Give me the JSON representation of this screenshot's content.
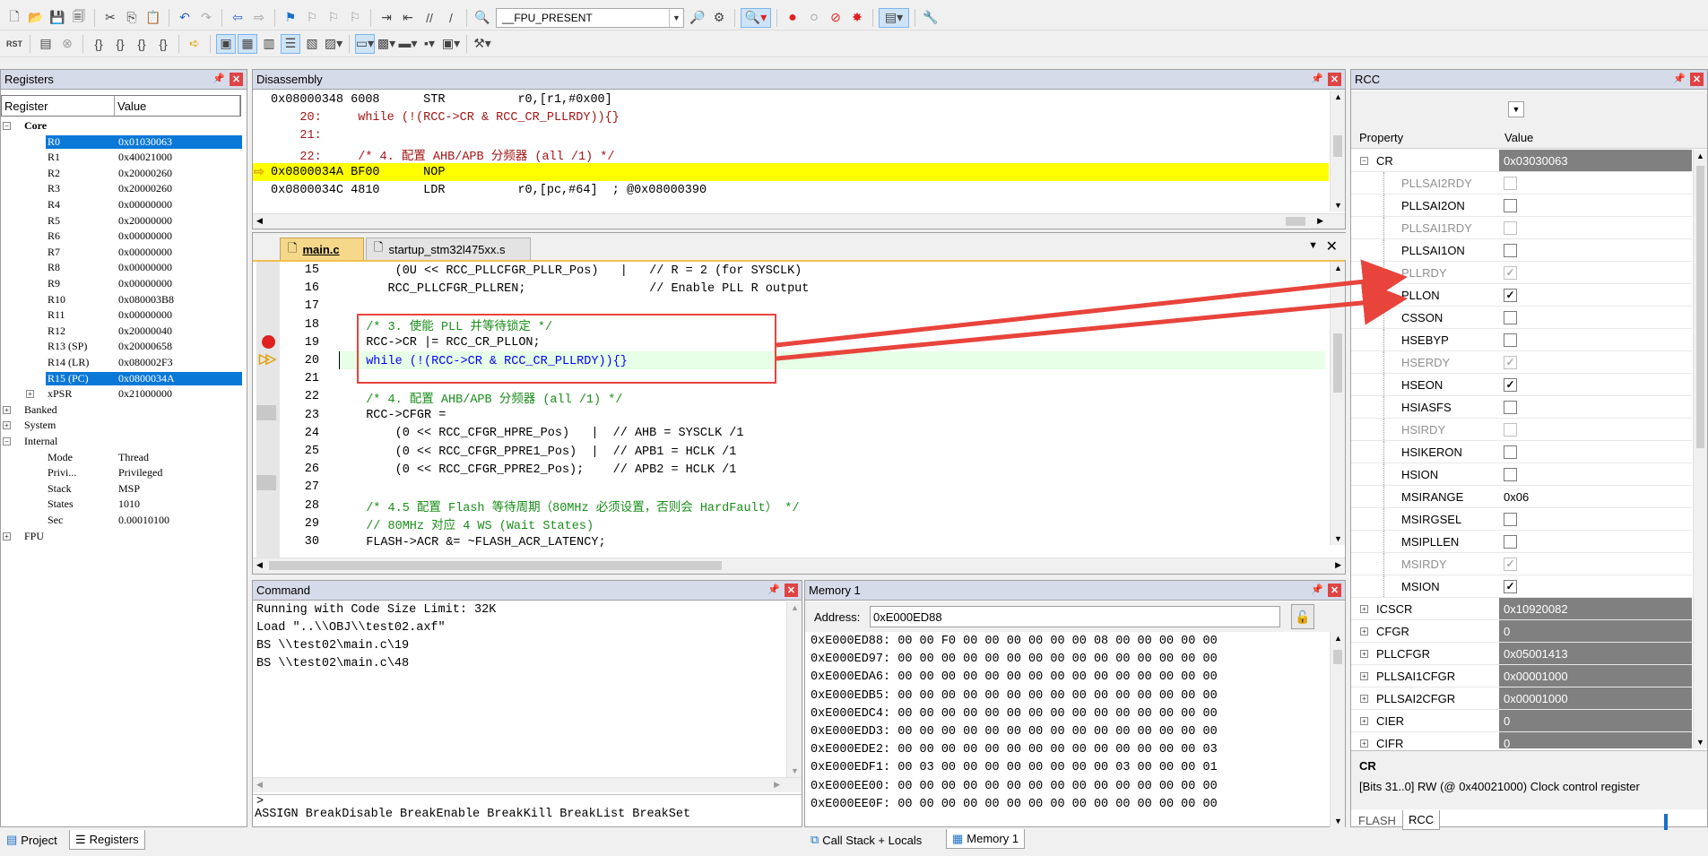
{
  "toolbar1": {
    "target_combo": "__FPU_PRESENT"
  },
  "registers": {
    "title": "Registers",
    "col_register": "Register",
    "col_value": "Value",
    "core_label": "Core",
    "rows": [
      {
        "name": "R0",
        "value": "0x01030063"
      },
      {
        "name": "R1",
        "value": "0x40021000"
      },
      {
        "name": "R2",
        "value": "0x20000260"
      },
      {
        "name": "R3",
        "value": "0x20000260"
      },
      {
        "name": "R4",
        "value": "0x00000000"
      },
      {
        "name": "R5",
        "value": "0x20000000"
      },
      {
        "name": "R6",
        "value": "0x00000000"
      },
      {
        "name": "R7",
        "value": "0x00000000"
      },
      {
        "name": "R8",
        "value": "0x00000000"
      },
      {
        "name": "R9",
        "value": "0x00000000"
      },
      {
        "name": "R10",
        "value": "0x080003B8"
      },
      {
        "name": "R11",
        "value": "0x00000000"
      },
      {
        "name": "R12",
        "value": "0x20000040"
      },
      {
        "name": "R13 (SP)",
        "value": "0x20000658"
      },
      {
        "name": "R14 (LR)",
        "value": "0x080002F3"
      },
      {
        "name": "R15 (PC)",
        "value": "0x0800034A"
      },
      {
        "name": "xPSR",
        "value": "0x21000000"
      }
    ],
    "banked": "Banked",
    "system": "System",
    "internal": "Internal",
    "internal_rows": [
      {
        "name": "Mode",
        "value": "Thread"
      },
      {
        "name": "Privi...",
        "value": "Privileged"
      },
      {
        "name": "Stack",
        "value": "MSP"
      },
      {
        "name": "States",
        "value": "1010"
      },
      {
        "name": "Sec",
        "value": "0.00010100"
      }
    ],
    "fpu": "FPU"
  },
  "disassembly": {
    "title": "Disassembly",
    "lines": [
      "0x08000348 6008      STR          r0,[r1,#0x00]",
      "    20:     while (!(RCC->CR & RCC_CR_PLLRDY)){}",
      "    21:",
      "    22:     /* 4. 配置 AHB/APB 分频器 (all /1) */",
      "0x0800034A BF00      NOP",
      "0x0800034C 4810      LDR          r0,[pc,#64]  ; @0x08000390"
    ]
  },
  "editor": {
    "tabs": [
      "main.c",
      "startup_stm32l475xx.s"
    ],
    "lines": [
      {
        "num": "15",
        "text": "      (0U << RCC_PLLCFGR_PLLR_Pos)   |   // R = 2 (for SYSCLK)"
      },
      {
        "num": "16",
        "text": "     RCC_PLLCFGR_PLLREN;                 // Enable PLL R output"
      },
      {
        "num": "17",
        "text": ""
      },
      {
        "num": "18",
        "text": "  /* 3. 使能 PLL 并等待锁定 */"
      },
      {
        "num": "19",
        "text": "  RCC->CR |= RCC_CR_PLLON;"
      },
      {
        "num": "20",
        "text": "  while (!(RCC->CR & RCC_CR_PLLRDY)){}"
      },
      {
        "num": "21",
        "text": ""
      },
      {
        "num": "22",
        "text": "  /* 4. 配置 AHB/APB 分频器 (all /1) */"
      },
      {
        "num": "23",
        "text": "  RCC->CFGR ="
      },
      {
        "num": "24",
        "text": "      (0 << RCC_CFGR_HPRE_Pos)   |  // AHB = SYSCLK /1"
      },
      {
        "num": "25",
        "text": "      (0 << RCC_CFGR_PPRE1_Pos)  |  // APB1 = HCLK /1"
      },
      {
        "num": "26",
        "text": "      (0 << RCC_CFGR_PPRE2_Pos);    // APB2 = HCLK /1"
      },
      {
        "num": "27",
        "text": ""
      },
      {
        "num": "28",
        "text": "  /* 4.5 配置 Flash 等待周期（80MHz 必须设置，否则会 HardFault） */"
      },
      {
        "num": "29",
        "text": "  // 80MHz 对应 4 WS (Wait States)"
      },
      {
        "num": "30",
        "text": "  FLASH->ACR &= ~FLASH_ACR_LATENCY;"
      }
    ]
  },
  "command": {
    "title": "Command",
    "lines": [
      "Running with Code Size Limit: 32K",
      "Load \"..\\\\OBJ\\\\test02.axf\"",
      "BS \\\\test02\\main.c\\19",
      "BS \\\\test02\\main.c\\48"
    ],
    "prompt": ">",
    "hint": "ASSIGN BreakDisable BreakEnable BreakKill BreakList BreakSet"
  },
  "memory": {
    "title": "Memory 1",
    "address_label": "Address:",
    "address_value": "0xE000ED88",
    "lines": [
      "0xE000ED88: 00 00 F0 00 00 00 00 00 00 08 00 00 00 00 00",
      "0xE000ED97: 00 00 00 00 00 00 00 00 00 00 00 00 00 00 00",
      "0xE000EDA6: 00 00 00 00 00 00 00 00 00 00 00 00 00 00 00",
      "0xE000EDB5: 00 00 00 00 00 00 00 00 00 00 00 00 00 00 00",
      "0xE000EDC4: 00 00 00 00 00 00 00 00 00 00 00 00 00 00 00",
      "0xE000EDD3: 00 00 00 00 00 00 00 00 00 00 00 00 00 00 00",
      "0xE000EDE2: 00 00 00 00 00 00 00 00 00 00 00 00 00 00 03",
      "0xE000EDF1: 00 03 00 00 00 00 00 00 00 00 03 00 00 00 01",
      "0xE000EE00: 00 00 00 00 00 00 00 00 00 00 00 00 00 00 00",
      "0xE000EE0F: 00 00 00 00 00 00 00 00 00 00 00 00 00 00 00"
    ]
  },
  "rcc": {
    "title": "RCC",
    "col_property": "Property",
    "col_value": "Value",
    "cr_name": "CR",
    "cr_value": "0x03030063",
    "bits": [
      {
        "name": "PLLSAI2RDY",
        "checked": false,
        "disabled": true
      },
      {
        "name": "PLLSAI2ON",
        "checked": false,
        "disabled": false
      },
      {
        "name": "PLLSAI1RDY",
        "checked": false,
        "disabled": true
      },
      {
        "name": "PLLSAI1ON",
        "checked": false,
        "disabled": false
      },
      {
        "name": "PLLRDY",
        "checked": true,
        "disabled": true
      },
      {
        "name": "PLLON",
        "checked": true,
        "disabled": false
      },
      {
        "name": "CSSON",
        "checked": false,
        "disabled": false
      },
      {
        "name": "HSEBYP",
        "checked": false,
        "disabled": false
      },
      {
        "name": "HSERDY",
        "checked": true,
        "disabled": true
      },
      {
        "name": "HSEON",
        "checked": true,
        "disabled": false
      },
      {
        "name": "HSIASFS",
        "checked": false,
        "disabled": false
      },
      {
        "name": "HSIRDY",
        "checked": false,
        "disabled": true
      },
      {
        "name": "HSIKERON",
        "checked": false,
        "disabled": false
      },
      {
        "name": "HSION",
        "checked": false,
        "disabled": false
      },
      {
        "name": "MSIRANGE",
        "value": "0x06"
      },
      {
        "name": "MSIRGSEL",
        "checked": false,
        "disabled": false
      },
      {
        "name": "MSIPLLEN",
        "checked": false,
        "disabled": false
      },
      {
        "name": "MSIRDY",
        "checked": true,
        "disabled": true
      },
      {
        "name": "MSION",
        "checked": true,
        "disabled": false
      }
    ],
    "groups": [
      {
        "name": "ICSCR",
        "value": "0x10920082"
      },
      {
        "name": "CFGR",
        "value": "0"
      },
      {
        "name": "PLLCFGR",
        "value": "0x05001413"
      },
      {
        "name": "PLLSAI1CFGR",
        "value": "0x00001000"
      },
      {
        "name": "PLLSAI2CFGR",
        "value": "0x00001000"
      },
      {
        "name": "CIER",
        "value": "0"
      },
      {
        "name": "CIFR",
        "value": "0"
      }
    ],
    "desc_title": "CR",
    "desc_text": "[Bits 31..0] RW (@ 0x40021000) Clock control register"
  },
  "bottom_tabs": {
    "project": "Project",
    "registers": "Registers",
    "callstack": "Call Stack + Locals",
    "memory1": "Memory 1",
    "flash": "FLASH",
    "rcc": "RCC"
  },
  "colors": {
    "highlight_yellow": "#ffff00",
    "selection_blue": "#0a78d7",
    "annotation_red": "#e8443c",
    "comment_green": "#1a8d1a"
  }
}
